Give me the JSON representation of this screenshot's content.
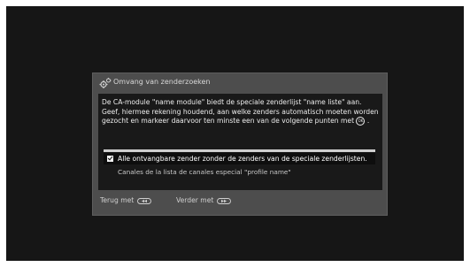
{
  "dialog": {
    "title": "Omvang van zenderzoeken",
    "icon": "gears-icon",
    "message": "De CA-module \"name module\" biedt de speciale zenderlijst \"name liste\" aan. Geef, hiermee rekening houdend, aan welke zenders automatisch moeten worden gezocht en markeer daarvoor ten minste een van de volgende punten met",
    "message_end": ".",
    "ok_key_label": "OK"
  },
  "options": [
    {
      "label": "Alle ontvangbare zender zonder de zenders van de speciale zenderlijsten.",
      "checked": true
    },
    {
      "label": "Canales de la lista de canales especial \"profile name\"",
      "checked": false
    }
  ],
  "footer": {
    "back_label": "Terug met",
    "back_icon": "rewind-key-icon",
    "next_label": "Verder met",
    "next_icon": "fast-forward-key-icon"
  },
  "colors": {
    "screen_bg": "#161616",
    "dialog_bg": "#4d4d4d",
    "content_bg": "#191919",
    "text": "#ececec"
  }
}
